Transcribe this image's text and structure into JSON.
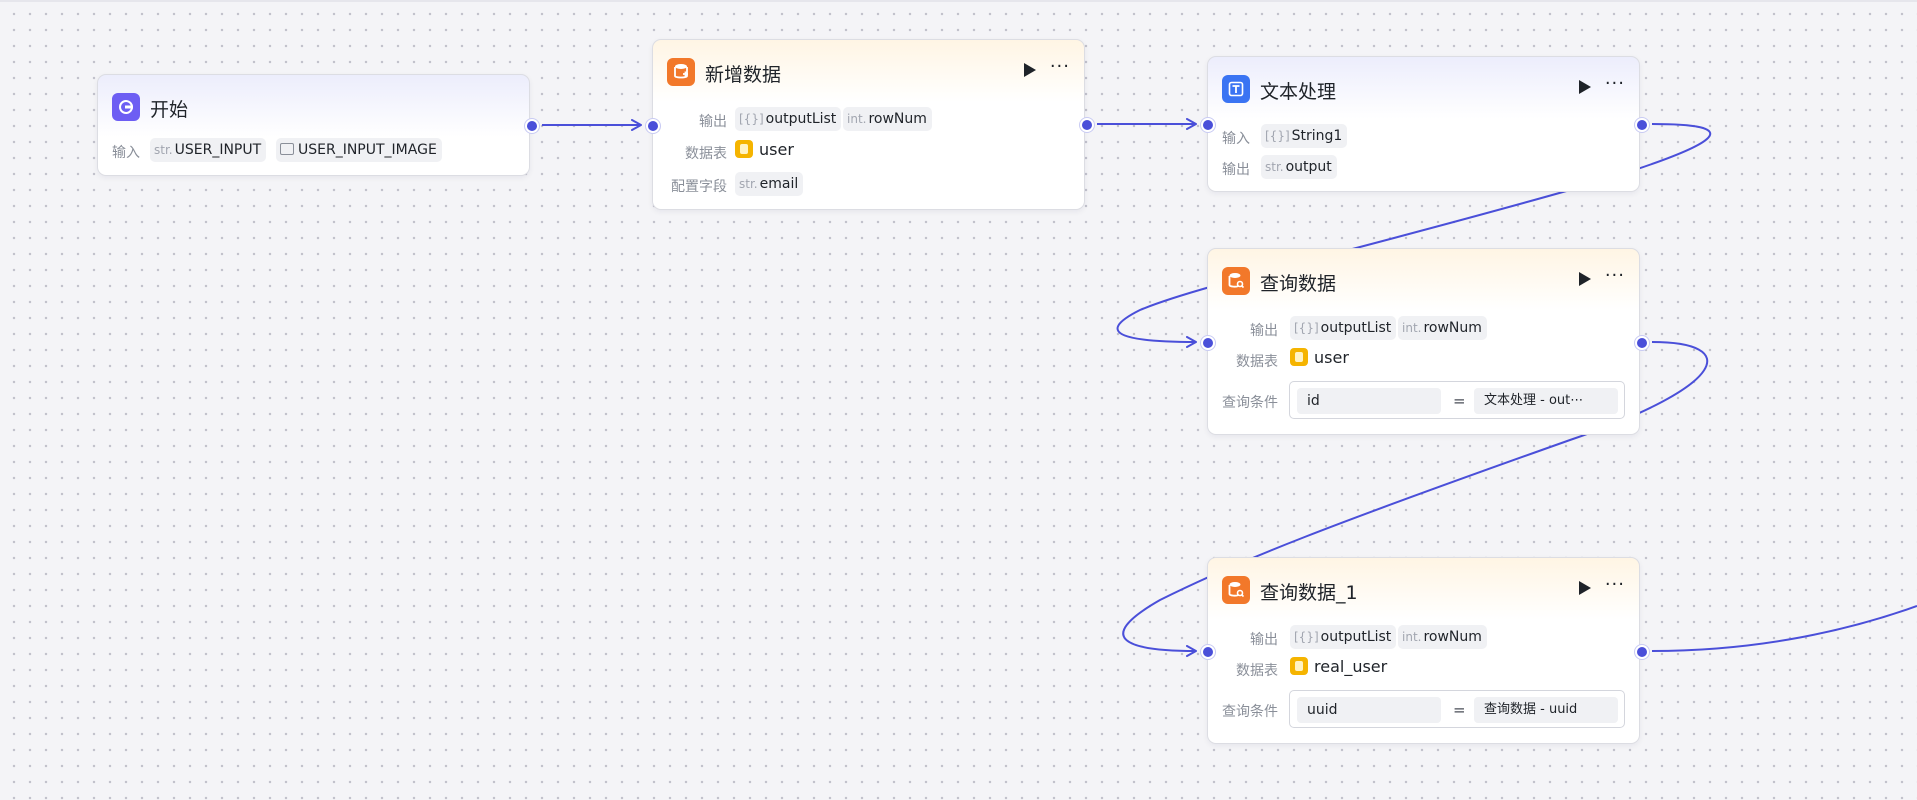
{
  "theme": {
    "edge_color": "#4a4fd9",
    "port_color": "#4a4fd9",
    "db_icon_color": "#f5b400"
  },
  "nodes": {
    "start": {
      "title": "开始",
      "icon": "start-icon",
      "input_label": "输入",
      "inputs": [
        {
          "type": "str.",
          "name": "USER_INPUT"
        },
        {
          "type": "image-icon",
          "name": "USER_INPUT_IMAGE"
        }
      ]
    },
    "add_data": {
      "title": "新增数据",
      "icon": "database-add-icon",
      "output_label": "输出",
      "outputs": [
        {
          "type": "[{}]",
          "name": "outputList"
        },
        {
          "type": "int.",
          "name": "rowNum"
        }
      ],
      "table_label": "数据表",
      "table": "user",
      "field_label": "配置字段",
      "field": {
        "type": "str.",
        "name": "email"
      }
    },
    "text_proc": {
      "title": "文本处理",
      "icon": "text-process-icon",
      "input_label": "输入",
      "input": {
        "type": "[{}]",
        "name": "String1"
      },
      "output_label": "输出",
      "output": {
        "type": "str.",
        "name": "output"
      }
    },
    "query": {
      "title": "查询数据",
      "icon": "database-query-icon",
      "output_label": "输出",
      "outputs": [
        {
          "type": "[{}]",
          "name": "outputList"
        },
        {
          "type": "int.",
          "name": "rowNum"
        }
      ],
      "table_label": "数据表",
      "table": "user",
      "cond_label": "查询条件",
      "cond_left": "id",
      "cond_op": "=",
      "cond_right": "文本处理 - out⋯"
    },
    "query1": {
      "title": "查询数据_1",
      "icon": "database-query-icon",
      "output_label": "输出",
      "outputs": [
        {
          "type": "[{}]",
          "name": "outputList"
        },
        {
          "type": "int.",
          "name": "rowNum"
        }
      ],
      "table_label": "数据表",
      "table": "real_user",
      "cond_label": "查询条件",
      "cond_left": "uuid",
      "cond_op": "=",
      "cond_right": "查询数据 - uuid"
    }
  },
  "toolbar": {
    "run_icon": "play-icon",
    "more_icon": "more-icon",
    "more_label": "···"
  }
}
